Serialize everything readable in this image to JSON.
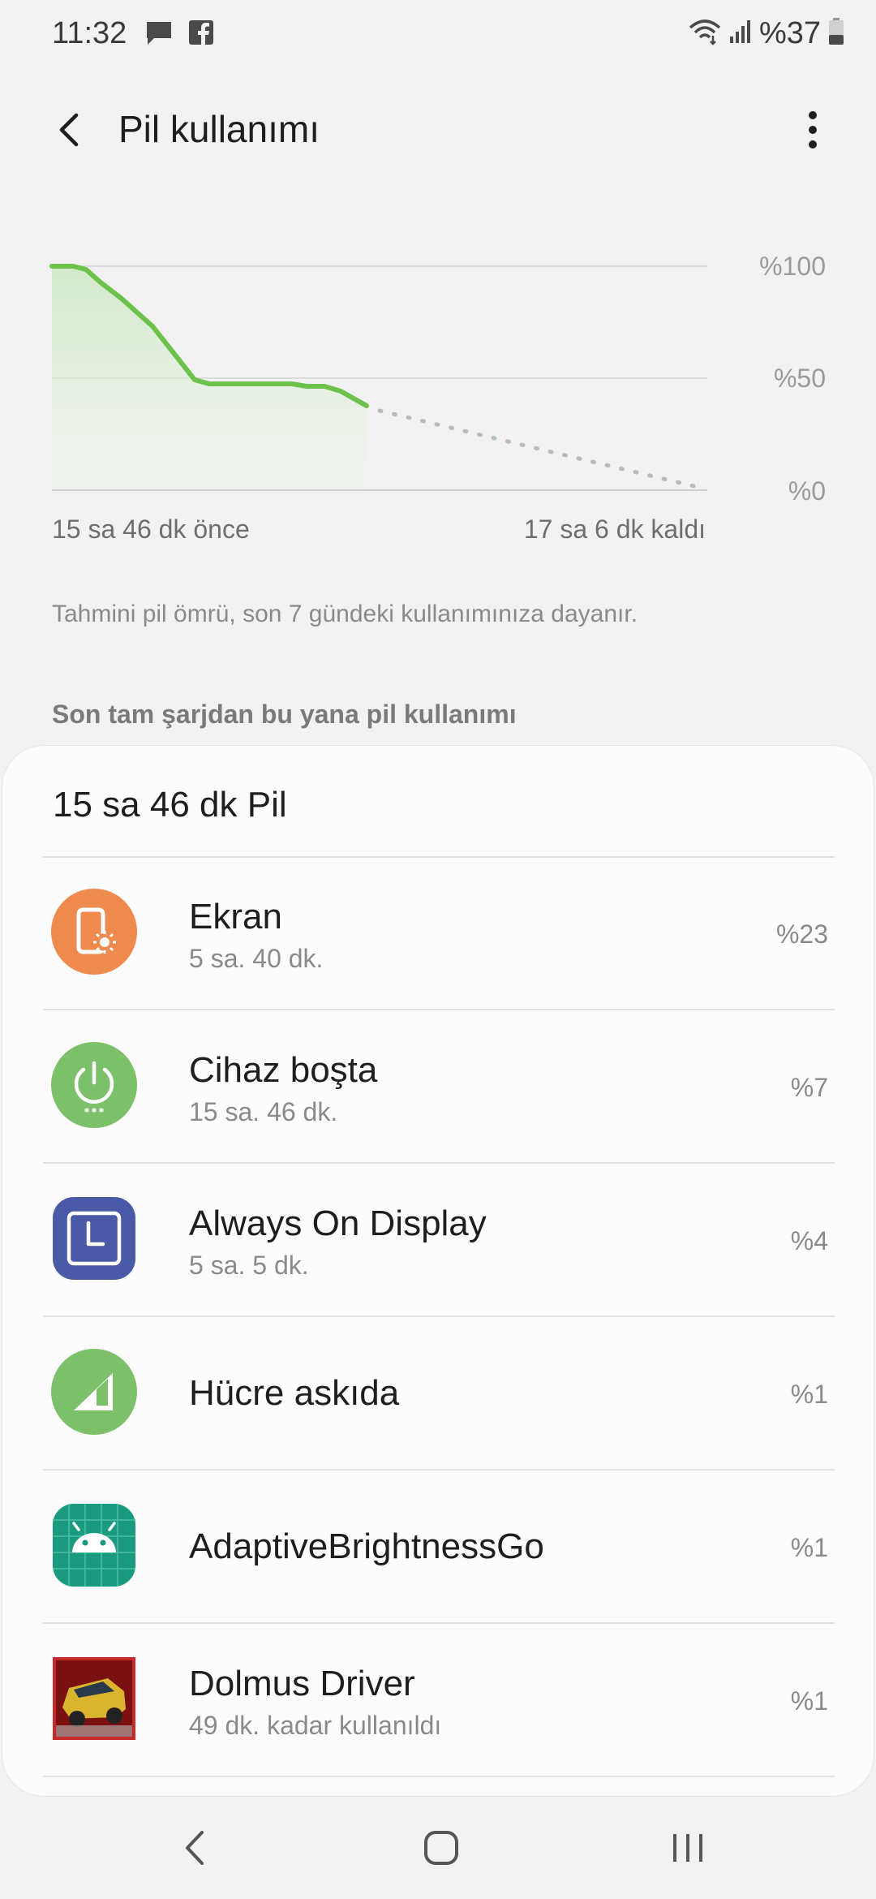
{
  "status_bar": {
    "time": "11:32",
    "battery_percent": "%37",
    "icons": [
      "message-icon",
      "facebook-icon",
      "wifi-icon",
      "signal-icon",
      "battery-icon"
    ]
  },
  "app_bar": {
    "title": "Pil kullanımı",
    "icons": [
      "back-arrow-icon",
      "more-vert-icon"
    ]
  },
  "graph": {
    "y_labels": [
      "%100",
      "%50",
      "%0"
    ],
    "left_label": "15 sa 46 dk önce",
    "right_label": "17 sa 6 dk kaldı",
    "line_color": "#6cc24a",
    "projection_color": "#b5bcc0"
  },
  "estimate_note": "Tahmini pil ömrü, son 7 gündeki kullanımınıza dayanır.",
  "section_title": "Son tam şarjdan bu yana pil kullanımı",
  "card": {
    "header": "15 sa 46 dk Pil",
    "items": [
      {
        "title": "Ekran",
        "subtitle": "5 sa. 40 dk.",
        "percent": "%23",
        "icon": "screen-brightness-icon",
        "color": "#ef8a4f"
      },
      {
        "title": "Cihaz boşta",
        "subtitle": "15 sa. 46 dk.",
        "percent": "%7",
        "icon": "power-icon",
        "color": "#7cc06a"
      },
      {
        "title": "Always On Display",
        "subtitle": "5 sa. 5 dk.",
        "percent": "%4",
        "icon": "clock-icon",
        "color": "#4b5aa6"
      },
      {
        "title": "Hücre askıda",
        "subtitle": "",
        "percent": "%1",
        "icon": "cell-signal-icon",
        "color": "#7cc06a"
      },
      {
        "title": "AdaptiveBrightnessGo",
        "subtitle": "",
        "percent": "%1",
        "icon": "android-icon",
        "color": "#1a9a7e"
      },
      {
        "title": "Dolmus Driver",
        "subtitle": "49 dk. kadar kullanıldı",
        "percent": "%1",
        "icon": "game-car-icon",
        "color": "#c62a2a"
      }
    ]
  },
  "nav_bar": {
    "icons": [
      "nav-back-icon",
      "nav-home-icon",
      "nav-recents-icon"
    ]
  }
}
